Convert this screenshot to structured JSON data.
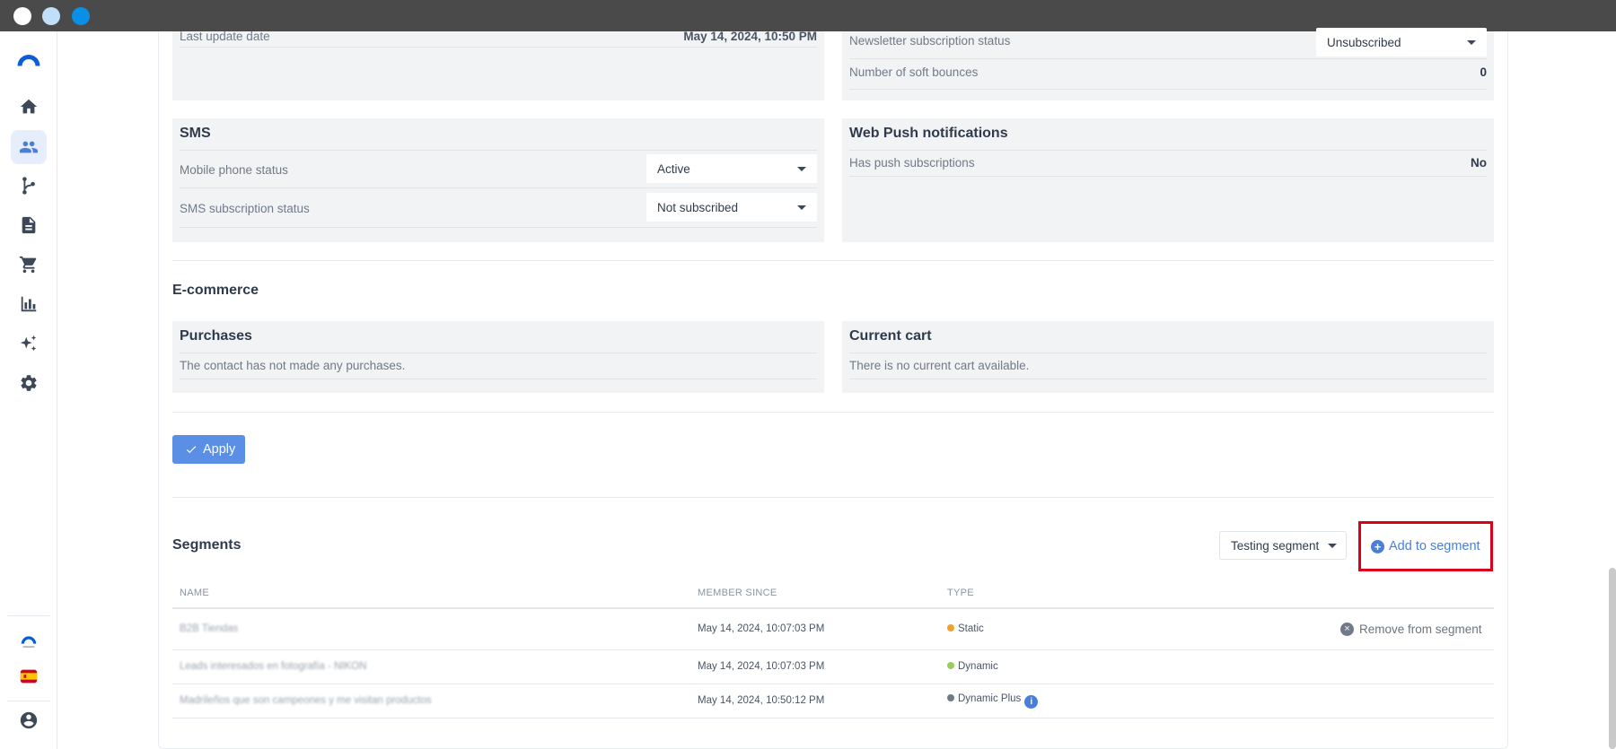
{
  "window": {},
  "sidebar": {
    "items": [
      {
        "name": "home",
        "icon": "home-icon"
      },
      {
        "name": "contacts",
        "icon": "people-icon",
        "active": true
      },
      {
        "name": "automations",
        "icon": "branch-icon"
      },
      {
        "name": "content",
        "icon": "document-icon"
      },
      {
        "name": "ecommerce",
        "icon": "cart-icon"
      },
      {
        "name": "reports",
        "icon": "bar-chart-icon"
      },
      {
        "name": "ai",
        "icon": "sparkles-icon"
      },
      {
        "name": "settings",
        "icon": "gear-icon"
      }
    ],
    "bottom": [
      {
        "name": "brand-logo-small",
        "icon": "logo-icon"
      },
      {
        "name": "language",
        "icon": "spain-flag-icon"
      },
      {
        "name": "profile",
        "icon": "user-circle-icon"
      }
    ]
  },
  "email_left": {
    "last_update_label": "Last update date",
    "last_update_value": "May 14, 2024, 10:50 PM"
  },
  "email_right": {
    "newsletter_label": "Newsletter subscription status",
    "newsletter_value": "Unsubscribed",
    "soft_bounces_label": "Number of soft bounces",
    "soft_bounces_value": "0"
  },
  "sms": {
    "title": "SMS",
    "mobile_status_label": "Mobile phone status",
    "mobile_status_value": "Active",
    "sms_status_label": "SMS subscription status",
    "sms_status_value": "Not subscribed"
  },
  "webpush": {
    "title": "Web Push notifications",
    "has_push_label": "Has push subscriptions",
    "has_push_value": "No"
  },
  "ecommerce": {
    "section_title": "E-commerce",
    "purchases_title": "Purchases",
    "purchases_note": "The contact has not made any purchases.",
    "cart_title": "Current cart",
    "cart_note": "There is no current cart available."
  },
  "apply": {
    "label": "Apply"
  },
  "segments": {
    "title": "Segments",
    "select_value": "Testing segment",
    "add_label": "Add to segment",
    "columns": [
      "NAME",
      "MEMBER SINCE",
      "TYPE"
    ],
    "remove_label": "Remove from segment",
    "rows": [
      {
        "name": "B2B Tiendas",
        "since": "May 14, 2024, 10:07:03 PM",
        "type": "Static",
        "dot": "#f0a030"
      },
      {
        "name": "Leads interesados en fotografía - NIKON",
        "since": "May 14, 2024, 10:07:03 PM",
        "type": "Dynamic",
        "dot": "#9acd5a"
      },
      {
        "name": "Madrileños que son campeones y me visitan productos",
        "since": "May 14, 2024, 10:50:12 PM",
        "type": "Dynamic Plus",
        "dot": "#707a88"
      }
    ]
  },
  "colors": {
    "accent": "#4a7fd9",
    "highlight_border": "#d9001b",
    "button": "#5b8fe5"
  }
}
